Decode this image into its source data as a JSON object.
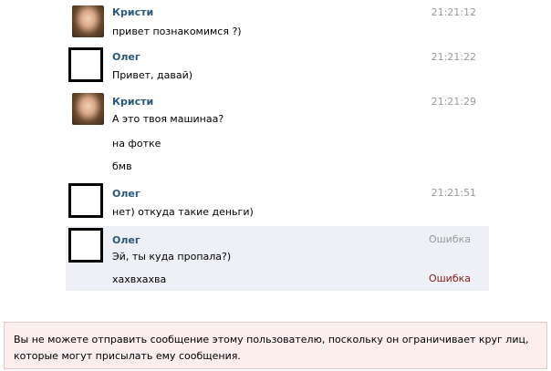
{
  "messages": [
    {
      "sender": "Кристи",
      "time": "21:21:12",
      "lines": [
        "привет познакомимся ?)"
      ]
    },
    {
      "sender": "Олег",
      "time": "21:21:22",
      "lines": [
        "Привет, давай)"
      ]
    },
    {
      "sender": "Кристи",
      "time": "21:21:29",
      "lines": [
        "А это твоя машинаа?",
        "на фотке",
        "бмв"
      ]
    },
    {
      "sender": "Олег",
      "time": "21:21:51",
      "lines": [
        "нет) откуда такие деньги)"
      ]
    },
    {
      "sender": "Олег",
      "time": "Ошибка",
      "lines": [
        "Эй, ты куда пропала?)",
        "хахвхахва"
      ],
      "line_status": "Ошибка"
    }
  ],
  "notice": "Вы не можете отправить сообщение этому пользователю, поскольку он ограничивает круг лиц, которые могут присылать ему сообщения."
}
